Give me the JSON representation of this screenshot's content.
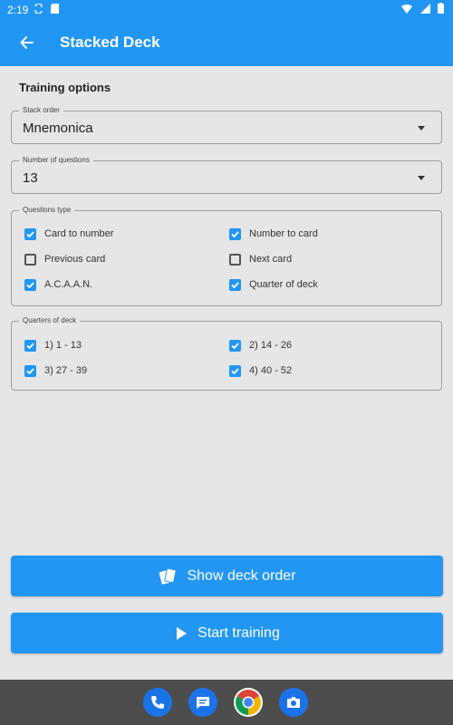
{
  "status_bar": {
    "time": "2:19"
  },
  "app_bar": {
    "title": "Stacked Deck"
  },
  "training_options": {
    "heading": "Training options"
  },
  "stack_order": {
    "label": "Stack order",
    "value": "Mnemonica"
  },
  "number_of_questions": {
    "label": "Number of questions",
    "value": "13"
  },
  "questions_type": {
    "label": "Questions type",
    "options": [
      {
        "label": "Card to number",
        "checked": true
      },
      {
        "label": "Number to card",
        "checked": true
      },
      {
        "label": "Previous card",
        "checked": false
      },
      {
        "label": "Next card",
        "checked": false
      },
      {
        "label": "A.C.A.A.N.",
        "checked": true
      },
      {
        "label": "Quarter of deck",
        "checked": true
      }
    ]
  },
  "quarters_of_deck": {
    "label": "Quarters of deck",
    "options": [
      {
        "label": "1) 1 - 13",
        "checked": true
      },
      {
        "label": "2) 14 - 26",
        "checked": true
      },
      {
        "label": "3) 27 - 39",
        "checked": true
      },
      {
        "label": "4) 40 - 52",
        "checked": true
      }
    ]
  },
  "buttons": {
    "show_deck_order": "Show deck order",
    "start_training": "Start training"
  },
  "colors": {
    "accent": "#2196f3",
    "background": "#e6e6e6",
    "nav_bar": "#4d4d4d"
  },
  "dock": {
    "icons": [
      "phone-icon",
      "messages-icon",
      "chrome-icon",
      "camera-icon"
    ]
  }
}
